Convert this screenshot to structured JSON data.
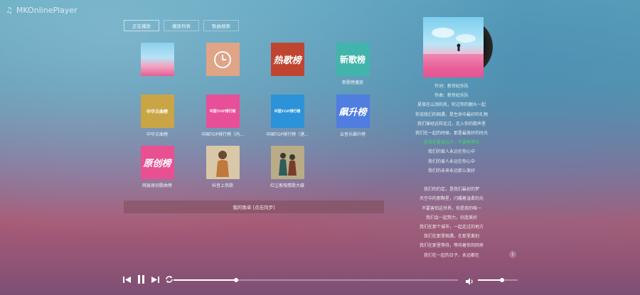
{
  "app": {
    "title": "MKOnlinePlayer",
    "icon": "music-note-icon"
  },
  "tabs": [
    {
      "label": "正在播放"
    },
    {
      "label": "播放列表"
    },
    {
      "label": "歌曲搜索"
    }
  ],
  "playlists": [
    {
      "label": "",
      "cover_text": ""
    },
    {
      "label": "",
      "cover_text": ""
    },
    {
      "label": "",
      "cover_text": "热歌榜"
    },
    {
      "label": "新歌榜播放",
      "cover_text": "新歌榜"
    },
    {
      "label": "中华古曲榜",
      "cover_text": "中华古曲榜"
    },
    {
      "label": "中国TOP排行榜（内...",
      "cover_text": "中国TOP排行榜"
    },
    {
      "label": "中国TOP排行榜（港...",
      "cover_text": "中国TOP排行榜"
    },
    {
      "label": "云音乐飙升榜",
      "cover_text": "飙升榜"
    },
    {
      "label": "网易原创歌曲榜",
      "cover_text": "原创榜"
    },
    {
      "label": "抖音上热歌",
      "cover_text": ""
    },
    {
      "label": "红尘客栈情歌大碟",
      "cover_text": ""
    }
  ],
  "status": {
    "text": "我的歌单 [点击同步]"
  },
  "lyrics": {
    "lines": [
      "作词：新世纪乐队",
      "作曲：新世纪乐队",
      "夏夜在山顶的风，吹过你的额头一起",
      "你说我们的相遇，是生命中最好的礼物",
      "我们曾经这样走过，走入你的歌声里",
      "我们在一起的时候，那是最美好的时光",
      "你说你要去远方，不要再等待",
      "我们的爱人永远在你心中",
      "我们的爱人永远在你心中",
      "我们的未来永远那么美好",
      "",
      "我们的约定，是我们最初的梦",
      "天空中的那颗星，闪耀着温柔的光",
      "不要害怕这世界，你是我的唯一",
      "我们会一起努力，创造美好",
      "我们在那个城市，一起走过的地方",
      "我们在那里相遇，在那里离别",
      "我们在那里等待，等待着你的回来",
      "我们在一起的日子，永远都在"
    ],
    "active_index": 6
  },
  "player": {
    "progress": 0.22,
    "volume": 0.6
  }
}
